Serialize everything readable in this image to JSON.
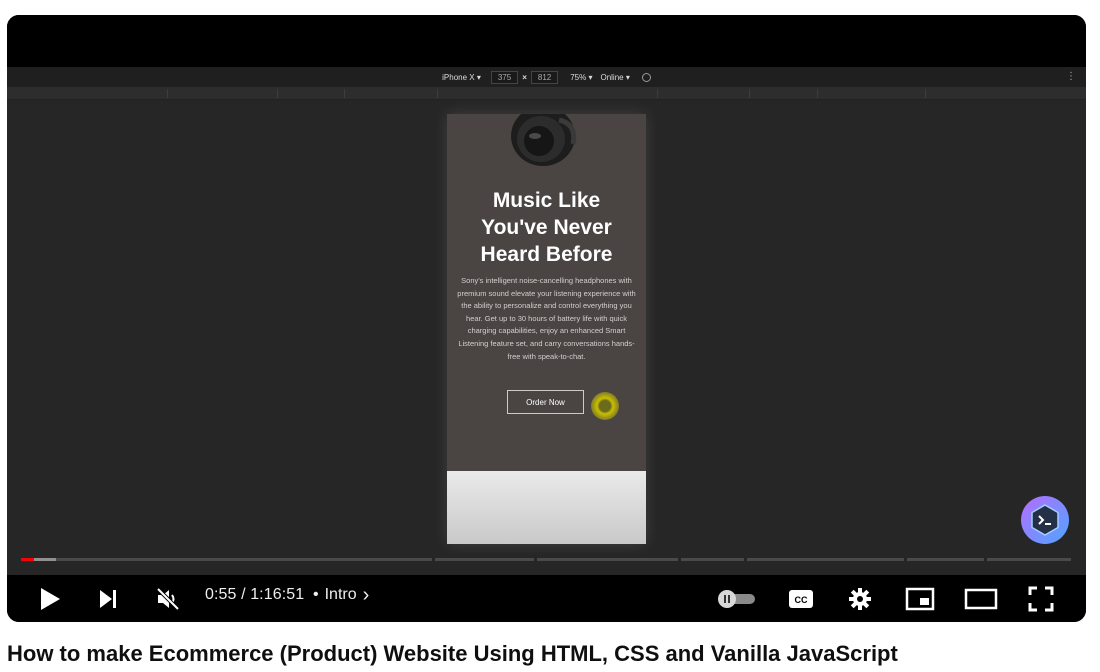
{
  "devtools": {
    "device": "iPhone X ▾",
    "width": "375",
    "times": "×",
    "height": "812",
    "zoom": "75% ▾",
    "network": "Online ▾",
    "more": "⋮"
  },
  "page": {
    "headline_line1": "Music Like",
    "headline_line2": "You've Never",
    "headline_line3": "Heard Before",
    "description": "Sony's intelligent noise-cancelling headphones with premium sound elevate your listening experience with the ability to personalize and control everything you hear. Get up to 30 hours of battery life with quick charging capabilities, enjoy an enhanced Smart Listening feature set, and carry conversations hands-free with speak-to-chat.",
    "cta": "Order Now"
  },
  "player": {
    "current_time": "0:55",
    "duration": "1:16:51",
    "time_sep": "/",
    "chapter_bullet": "•",
    "chapter": "Intro",
    "progress_fraction": 0.012,
    "colors": {
      "progress_played": "#ff0000",
      "progress_buffered": "#909090",
      "progress_track": "#4a4a4a",
      "accent_badge_start": "#b56cff",
      "accent_badge_end": "#4ea6ff"
    },
    "icons": [
      "play-icon",
      "next-icon",
      "muted-volume-icon",
      "autoplay-toggle-icon",
      "closed-captions-icon",
      "settings-gear-icon",
      "miniplayer-icon",
      "theater-mode-icon",
      "fullscreen-icon",
      "channel-watermark-icon"
    ]
  },
  "video_title": "How to make Ecommerce (Product) Website Using HTML, CSS and Vanilla JavaScript"
}
